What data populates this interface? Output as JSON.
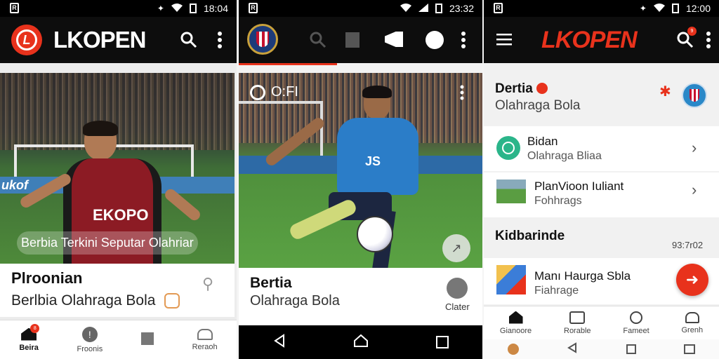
{
  "screen1": {
    "status_time": "18:04",
    "app_name": "LKOPEN",
    "hero_caption": "Berbia Terkini Seputar Olahriar",
    "jersey_text": "EKOPO",
    "banner_text": "ukof",
    "card_title": "Plroonian",
    "card_subtitle": "Berlbia Olahraga Bola",
    "nav": [
      {
        "label": "Beira",
        "icon": "home-icon",
        "badge": "8"
      },
      {
        "label": "Froonis",
        "icon": "alert-icon"
      },
      {
        "label": "",
        "icon": "bookmark-icon"
      },
      {
        "label": "Reraoh",
        "icon": "bell-icon"
      }
    ]
  },
  "screen2": {
    "status_time": "23:32",
    "hero_tag": "O:FI",
    "jersey_text": "JS",
    "card_title": "Bertia",
    "card_subtitle": "Olahraga Bola",
    "action_label": "Clater"
  },
  "screen3": {
    "status_time": "12:00",
    "app_name": "LKOPEN",
    "search_badge": "9",
    "header_title": "Dertia",
    "header_subtitle": "Olahraga Bola",
    "rows": [
      {
        "title": "Bidan",
        "subtitle": "Olahraga Bliaa"
      },
      {
        "title": "PlanVioon Iuliant",
        "subtitle": "Fohhrags"
      }
    ],
    "section_title": "Kidbarinde",
    "section_time": "93:7r02",
    "row3": {
      "title": "Manı Haurga Sbla",
      "subtitle": "Fiahrage"
    },
    "nav": [
      {
        "label": "Gianoore"
      },
      {
        "label": "Rorable"
      },
      {
        "label": "Fameet"
      },
      {
        "label": "Grenh"
      }
    ]
  },
  "colors": {
    "accent": "#e8321c",
    "dark": "#0d0d0d",
    "blue_jersey": "#2b7dc8",
    "red_jersey": "#8c1b24"
  }
}
